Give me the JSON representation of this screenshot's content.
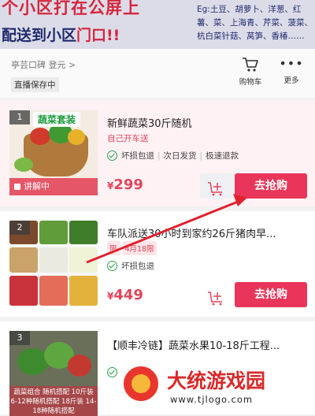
{
  "banner": {
    "line1": "个小区打在公屏上",
    "line2_main": "配送到小区",
    "line2_highlight": "门口!!",
    "right_text": "Eg:土豆、胡萝卜、洋葱、红薯、菜、上海青、芹菜、菠菜、杭白菜针菇、莴笋、香椿……"
  },
  "header": {
    "store_name": "亭芸口碑 登元 >",
    "live_tag": "直播保存中",
    "cart_label": "购物车",
    "more_label": "更多",
    "more_icon": "more-dots-icon",
    "cart_icon": "shopping-cart-icon"
  },
  "products": [
    {
      "rank": "1",
      "thumb_label": "蔬菜套装",
      "live_ribbon": "讲解中",
      "title": "新鲜蔬菜30斤随机",
      "sub_tag": "自己开车送",
      "services": [
        "坏损包退",
        "次日发货",
        "极速退款"
      ],
      "price_symbol": "¥",
      "price": "299",
      "buy_label": "去抢购"
    },
    {
      "rank": "2",
      "title": "车队派送30小时到家约26斤猪肉早...",
      "tags": [
        "限",
        "4月18限"
      ],
      "services": [
        "坏损包退"
      ],
      "price_symbol": "¥",
      "price": "449",
      "buy_label": "去抢购"
    },
    {
      "rank": "3",
      "thumb_caption": "蔬菜组合 随机搭配 10斤装 6-12种随机搭配 18斤装 14-18种随机搭配",
      "title": "【顺丰冷链】蔬菜水果10-18斤工程...",
      "services": [
        ""
      ]
    }
  ],
  "watermark": {
    "name": "大统游戏园",
    "url": "www.tjlogo.com"
  },
  "colors": {
    "accent": "#e83559",
    "price": "#e2455b",
    "check": "#2aa24a",
    "banner_red": "#d6263d",
    "banner_blue": "#1f2a6e"
  }
}
